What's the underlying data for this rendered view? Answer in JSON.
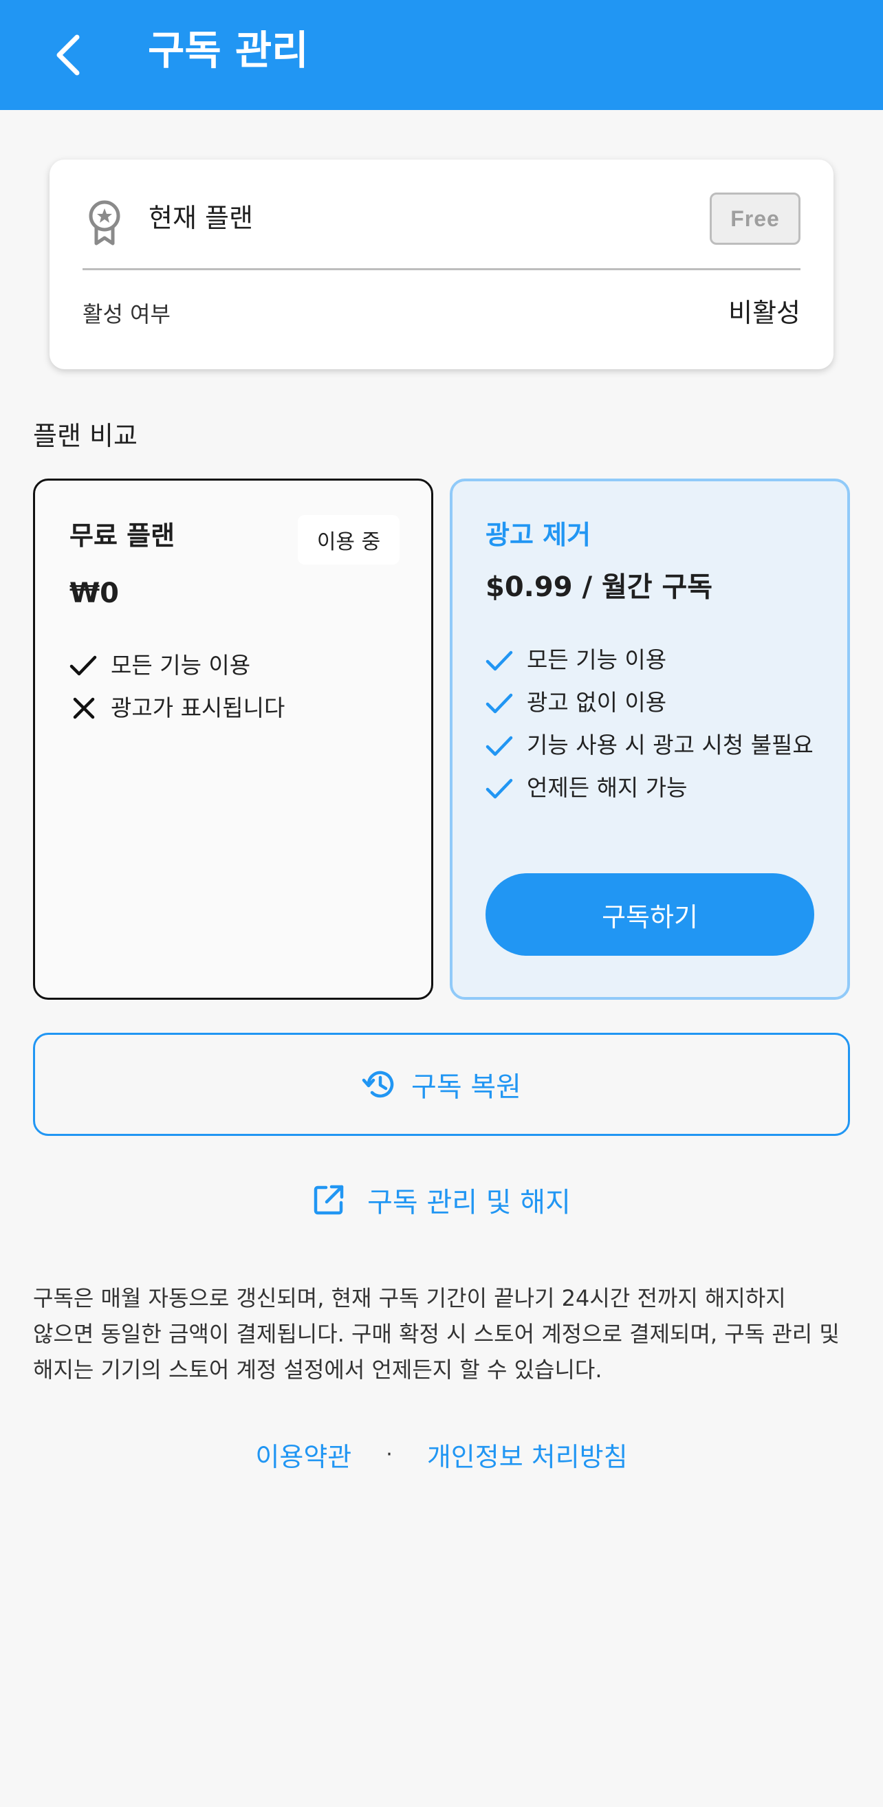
{
  "appbar": {
    "title": "구독 관리"
  },
  "current_plan": {
    "label": "현재 플랜",
    "badge": "Free",
    "active_label": "활성 여부",
    "active_value": "비활성"
  },
  "compare": {
    "title": "플랜 비교",
    "free_plan": {
      "name": "무료 플랜",
      "badge": "이용 중",
      "price": "₩0",
      "features": [
        {
          "icon": "check-icon",
          "text": "모든 기능 이용"
        },
        {
          "icon": "close-icon",
          "text": "광고가 표시됩니다"
        }
      ]
    },
    "pro_plan": {
      "name": "광고 제거",
      "price": "$0.99 / 월간 구독",
      "features": [
        {
          "icon": "check-icon",
          "text": "모든 기능 이용"
        },
        {
          "icon": "check-icon",
          "text": "광고 없이 이용"
        },
        {
          "icon": "check-icon",
          "text": "기능 사용 시 광고 시청 불필요"
        },
        {
          "icon": "check-icon",
          "text": "언제든 해지 가능"
        }
      ],
      "subscribe_label": "구독하기"
    }
  },
  "restore": {
    "label": "구독 복원",
    "icon": "history-icon"
  },
  "manage": {
    "label": "구독 관리 및 해지",
    "icon": "open-in-new-icon"
  },
  "notice": "구독은 매월 자동으로 갱신되며, 현재 구독 기간이 끝나기 24시간 전까지 해지하지 않으면 동일한 금액이 결제됩니다. 구매 확정 시 스토어 계정으로 결제되며, 구독 관리 및 해지는 기기의 스토어 계정 설정에서 언제든지 할 수 있습니다.",
  "footer": {
    "terms": "이용약관",
    "separator": "·",
    "privacy": "개인정보 처리방침"
  },
  "colors": {
    "primary": "#2196f3",
    "pro_card_bg": "#e9f2fa",
    "pro_card_border": "#90caf9",
    "page_bg": "#f7f7f7"
  }
}
